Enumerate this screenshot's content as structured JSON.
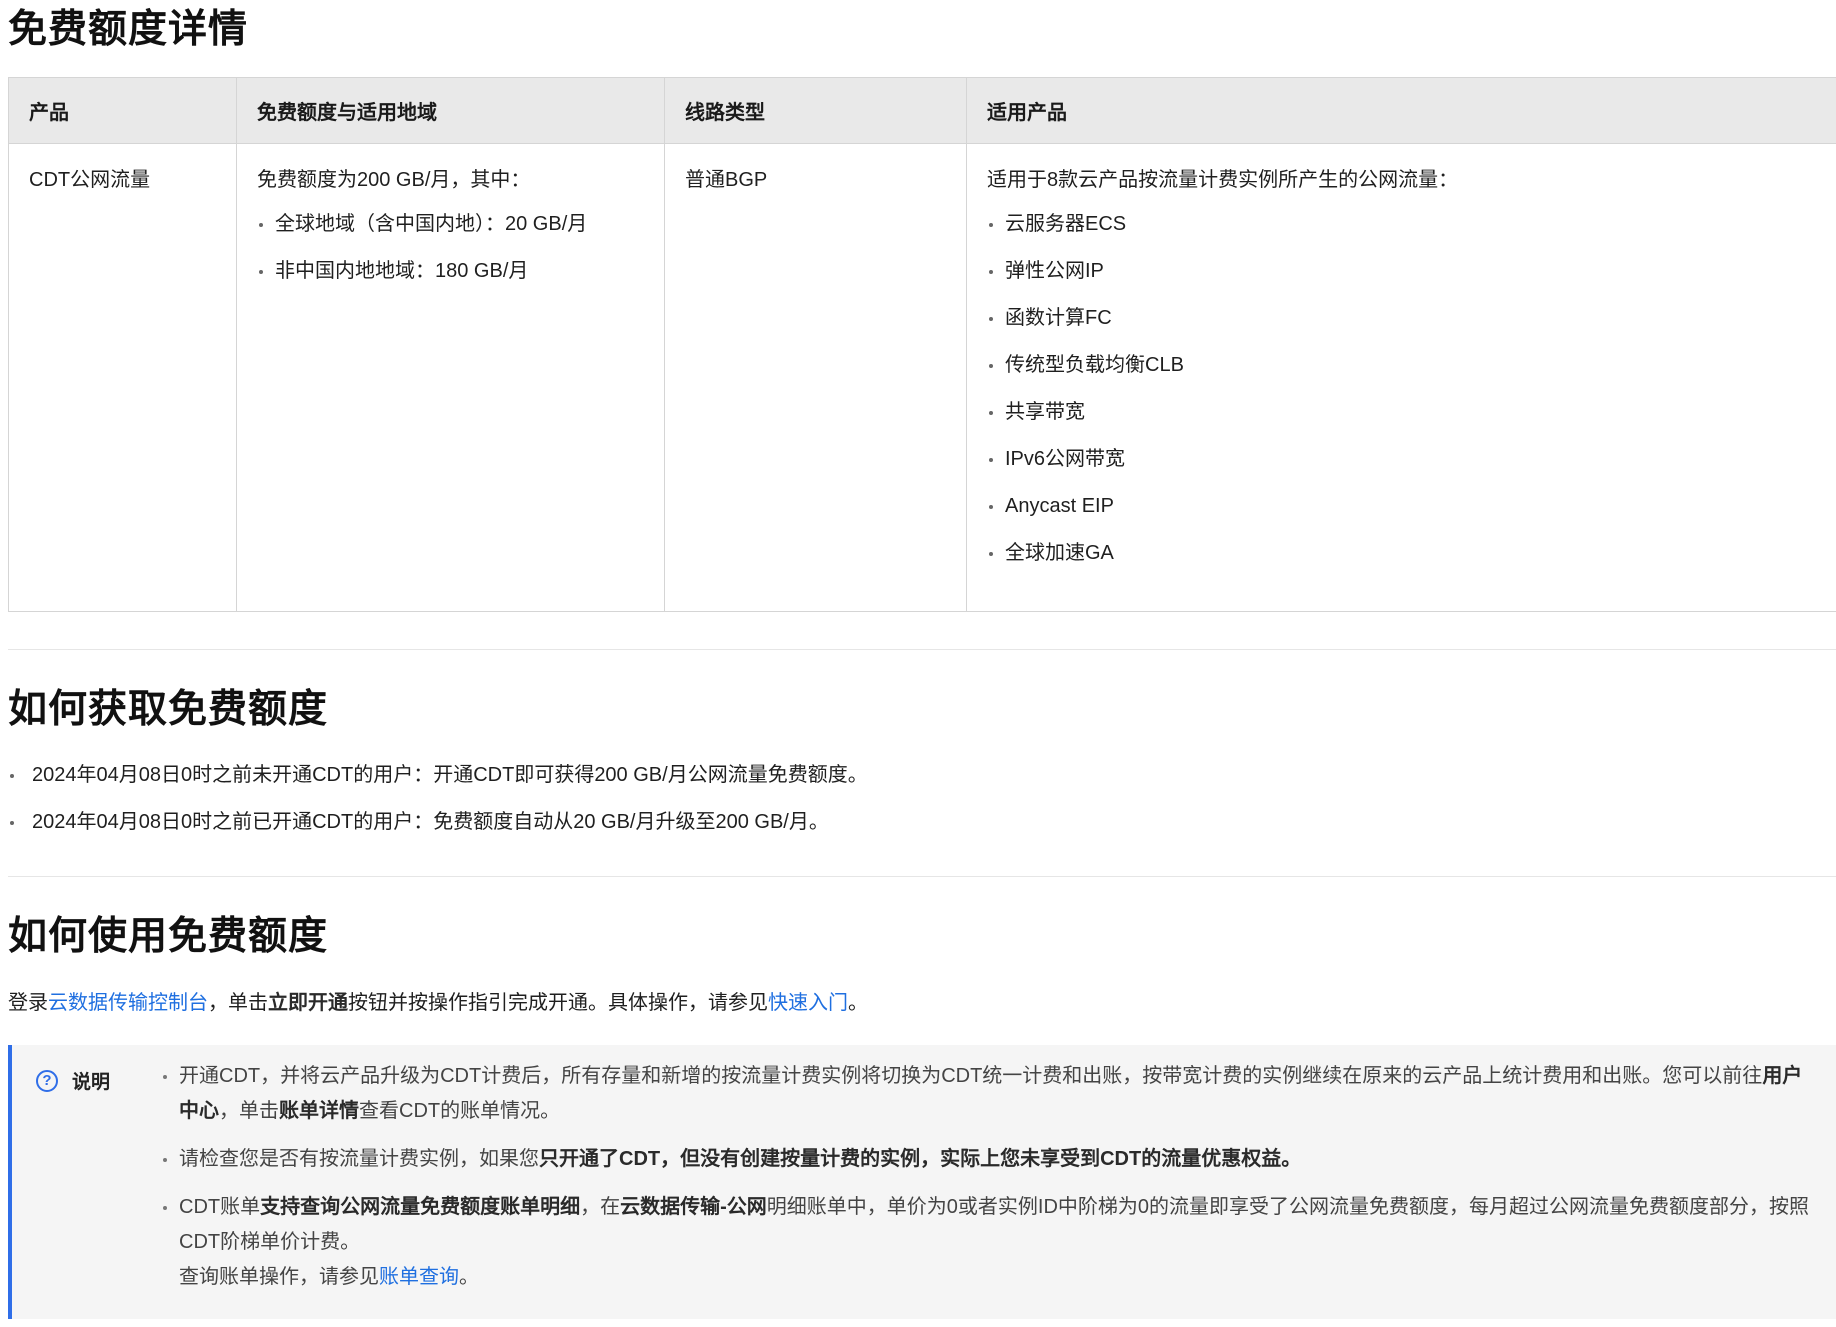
{
  "section1": {
    "title": "免费额度详情",
    "table": {
      "headers": [
        "产品",
        "免费额度与适用地域",
        "线路类型",
        "适用产品"
      ],
      "product": "CDT公网流量",
      "quota_intro": "免费额度为200 GB/月，其中：",
      "quota_items": [
        "全球地域（含中国内地）：20 GB/月",
        "非中国内地地域：180 GB/月"
      ],
      "line_type": "普通BGP",
      "applicable_intro": "适用于8款云产品按流量计费实例所产生的公网流量：",
      "applicable_items": [
        "云服务器ECS",
        "弹性公网IP",
        "函数计算FC",
        "传统型负载均衡CLB",
        "共享带宽",
        "IPv6公网带宽",
        "Anycast EIP",
        "全球加速GA"
      ]
    }
  },
  "section2": {
    "title": "如何获取免费额度",
    "items": [
      "2024年04月08日0时之前未开通CDT的用户：开通CDT即可获得200 GB/月公网流量免费额度。",
      "2024年04月08日0时之前已开通CDT的用户：免费额度自动从20 GB/月升级至200 GB/月。"
    ]
  },
  "section3": {
    "title": "如何使用免费额度",
    "p_1": "登录",
    "p_link_console": "云数据传输控制台",
    "p_2": "，单击",
    "p_bold": "立即开通",
    "p_3": "按钮并按操作指引完成开通。具体操作，请参见",
    "p_link_quick": "快速入门",
    "p_4": "。"
  },
  "note": {
    "title": "说明",
    "icon": "question-circle-icon",
    "n1_a": "开通CDT，并将云产品升级为CDT计费后，所有存量和新增的按流量计费实例将切换为CDT统一计费和出账，按带宽计费的实例继续在原来的云产品上统计费用和出账。您可以前往",
    "n1_b": "用户中心",
    "n1_c": "，单击",
    "n1_d": "账单详情",
    "n1_e": "查看CDT的账单情况。",
    "n2_a": "请检查您是否有按流量计费实例，如果您",
    "n2_b": "只开通了CDT，但没有创建按量计费的实例，实际上您未享受到CDT的流量优惠权益。",
    "n3_a": "CDT账单",
    "n3_b": "支持查询公网流量免费额度账单明细",
    "n3_c": "，在",
    "n3_d": "云数据传输-公网",
    "n3_e": "明细账单中，单价为0或者实例ID中阶梯为0的流量即享受了公网流量免费额度，每月超过公网流量免费额度部分，按照CDT阶梯单价计费。",
    "n3_f": "查询账单操作，请参见",
    "n3_link": "账单查询",
    "n3_g": "。"
  },
  "colors": {
    "link": "#1f6fe0",
    "note_border": "#2f6ee8",
    "header_bg": "#e9e9e9"
  }
}
